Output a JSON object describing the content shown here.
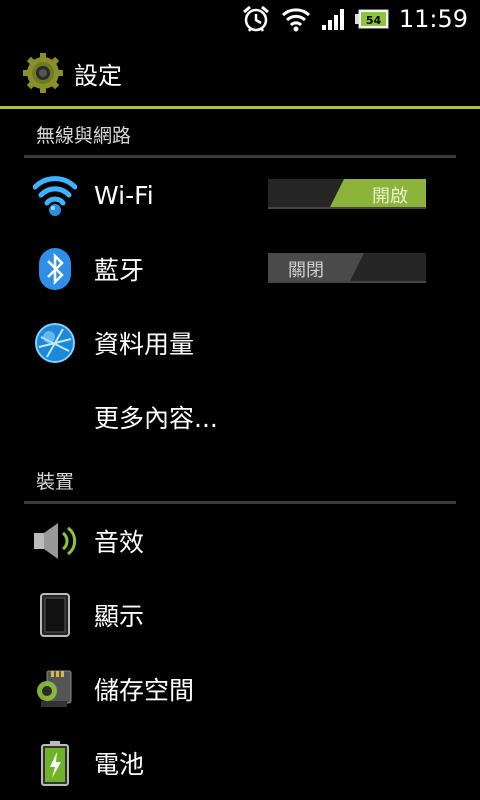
{
  "status_bar": {
    "time": "11:59",
    "battery_level": "54",
    "icons": [
      "alarm-icon",
      "wifi-signal-icon",
      "cell-signal-icon",
      "battery-icon"
    ]
  },
  "action_bar": {
    "title": "設定",
    "icon": "settings-gear-icon",
    "accent_color": "#a6c435"
  },
  "sections": [
    {
      "header": "無線與網路",
      "items": [
        {
          "label": "Wi-Fi",
          "icon": "wifi-icon",
          "toggle": "開啟"
        },
        {
          "label": "藍牙",
          "icon": "bluetooth-icon",
          "toggle": "關閉"
        },
        {
          "label": "資料用量",
          "icon": "data-usage-icon"
        },
        {
          "label": "更多內容..."
        }
      ]
    },
    {
      "header": "裝置",
      "items": [
        {
          "label": "音效",
          "icon": "speaker-icon"
        },
        {
          "label": "顯示",
          "icon": "display-icon"
        },
        {
          "label": "儲存空間",
          "icon": "storage-icon"
        },
        {
          "label": "電池",
          "icon": "battery-charging-icon"
        }
      ]
    }
  ]
}
